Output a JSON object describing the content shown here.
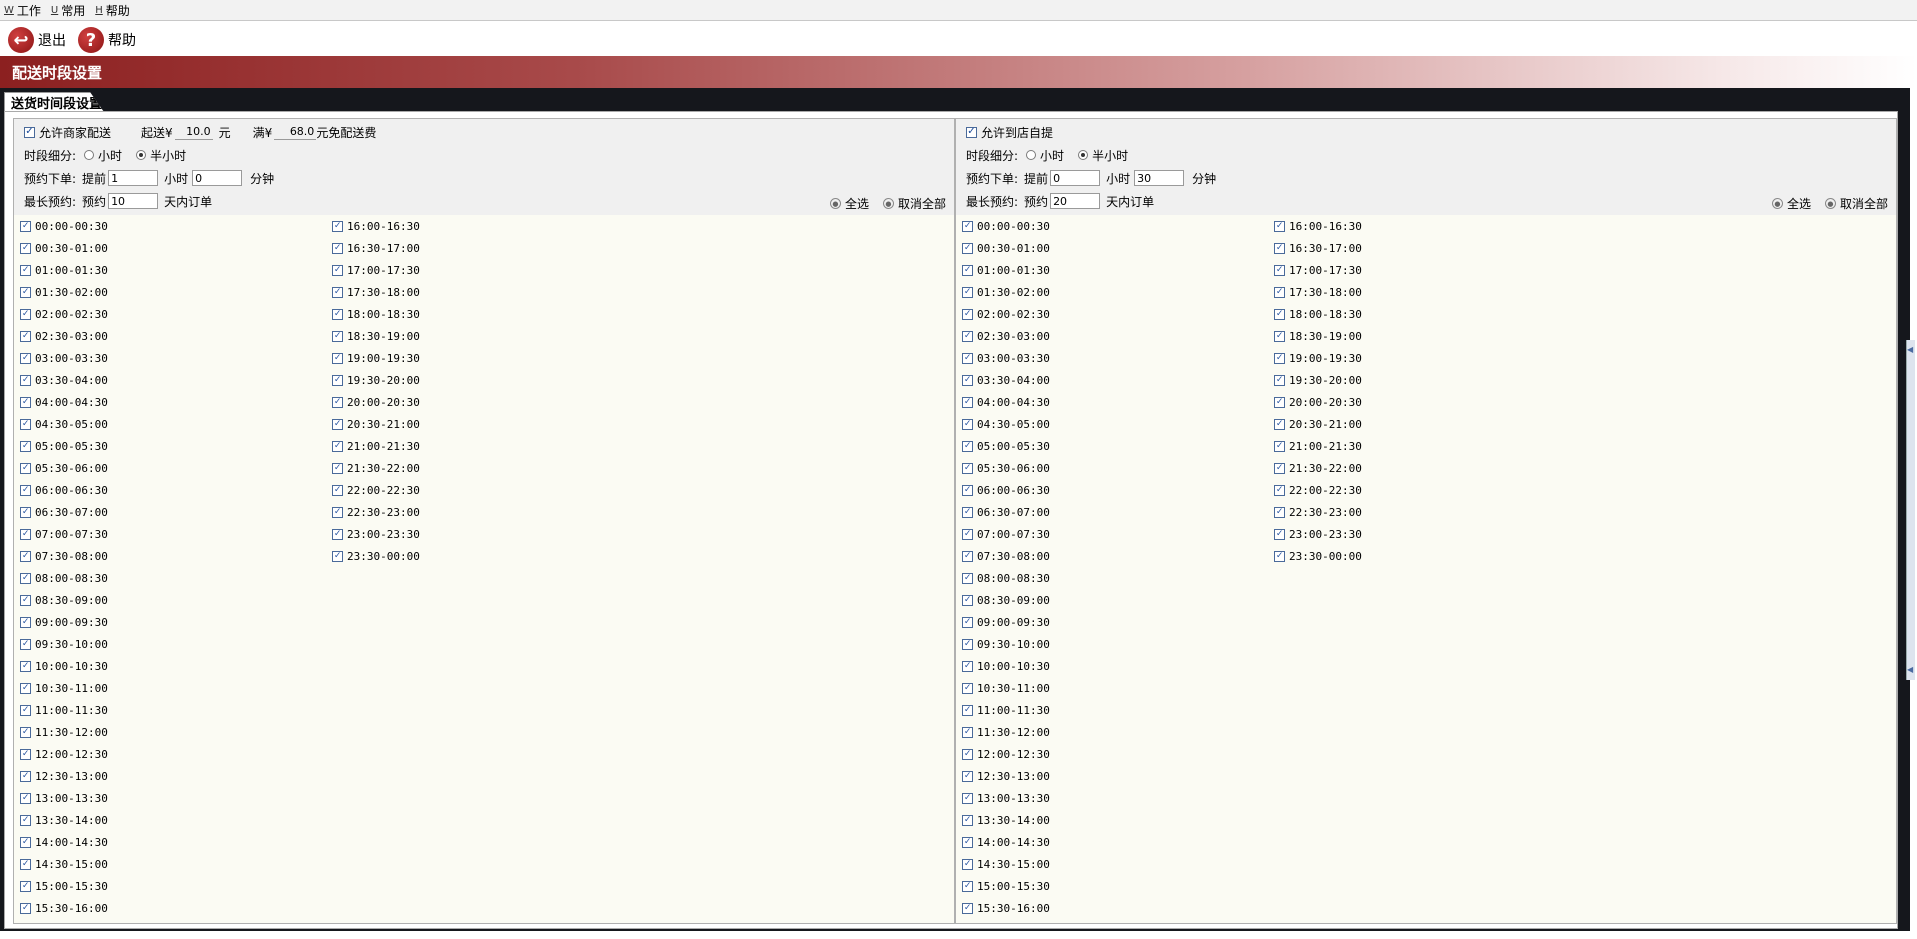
{
  "menubar": {
    "items": [
      {
        "hotkey": "W",
        "label": "工作"
      },
      {
        "hotkey": "U",
        "label": "常用"
      },
      {
        "hotkey": "H",
        "label": "帮助"
      }
    ]
  },
  "toolbar": {
    "exit_label": "退出",
    "help_label": "帮助"
  },
  "page_title": "配送时段设置",
  "tab_label": "送货时间段设置",
  "left_panel": {
    "enable_label": "允许商家配送",
    "min_order_label": "起送¥",
    "min_order_value": "10.0",
    "min_order_unit": "元",
    "free_label": "满¥",
    "free_value": "68.0",
    "free_unit": "元免配送费",
    "granularity_label": "时段细分:",
    "opt_hour": "小时",
    "opt_half": "半小时",
    "advance_label": "预约下单:",
    "advance_prefix": "提前",
    "advance_hours": "1",
    "hours_unit": "小时",
    "advance_minutes": "0",
    "minutes_unit": "分钟",
    "max_label": "最长预约:",
    "max_prefix": "预约",
    "max_days": "10",
    "max_unit": "天内订单",
    "select_all": "全选",
    "deselect_all": "取消全部"
  },
  "right_panel": {
    "enable_label": "允许到店自提",
    "granularity_label": "时段细分:",
    "opt_hour": "小时",
    "opt_half": "半小时",
    "advance_label": "预约下单:",
    "advance_prefix": "提前",
    "advance_hours": "0",
    "hours_unit": "小时",
    "advance_minutes": "30",
    "minutes_unit": "分钟",
    "max_label": "最长预约:",
    "max_prefix": "预约",
    "max_days": "20",
    "max_unit": "天内订单",
    "select_all": "全选",
    "deselect_all": "取消全部"
  },
  "check_mark": "✓",
  "time_slots": [
    "00:00-00:30",
    "00:30-01:00",
    "01:00-01:30",
    "01:30-02:00",
    "02:00-02:30",
    "02:30-03:00",
    "03:00-03:30",
    "03:30-04:00",
    "04:00-04:30",
    "04:30-05:00",
    "05:00-05:30",
    "05:30-06:00",
    "06:00-06:30",
    "06:30-07:00",
    "07:00-07:30",
    "07:30-08:00",
    "08:00-08:30",
    "08:30-09:00",
    "09:00-09:30",
    "09:30-10:00",
    "10:00-10:30",
    "10:30-11:00",
    "11:00-11:30",
    "11:30-12:00",
    "12:00-12:30",
    "12:30-13:00",
    "13:00-13:30",
    "13:30-14:00",
    "14:00-14:30",
    "14:30-15:00",
    "15:00-15:30",
    "15:30-16:00",
    "16:00-16:30",
    "16:30-17:00",
    "17:00-17:30",
    "17:30-18:00",
    "18:00-18:30",
    "18:30-19:00",
    "19:00-19:30",
    "19:30-20:00",
    "20:00-20:30",
    "20:30-21:00",
    "21:00-21:30",
    "21:30-22:00",
    "22:00-22:30",
    "22:30-23:00",
    "23:00-23:30",
    "23:30-00:00"
  ],
  "colors": {
    "banner_start": "#8c2020",
    "frame": "#15171c",
    "panel_bg": "#fbfbf3",
    "check": "#1a4a9a"
  }
}
